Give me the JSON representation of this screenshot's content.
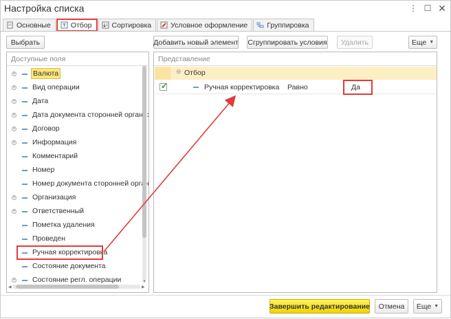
{
  "window": {
    "title": "Настройка списка",
    "more_icon": "more-vertical-icon",
    "maximize_icon": "maximize-icon",
    "close_icon": "close-icon"
  },
  "tabs": [
    {
      "label": "Основные",
      "icon": "document-icon",
      "active": false
    },
    {
      "label": "Отбор",
      "icon": "filter-icon",
      "active": true
    },
    {
      "label": "Сортировка",
      "icon": "sort-icon",
      "active": false
    },
    {
      "label": "Условное оформление",
      "icon": "conditional-format-icon",
      "active": false
    },
    {
      "label": "Группировка",
      "icon": "grouping-icon",
      "active": false
    }
  ],
  "left_panel": {
    "select_button": "Выбрать",
    "header": "Доступные поля",
    "fields": [
      {
        "label": "Валюта",
        "expandable": true,
        "selected": true
      },
      {
        "label": "Вид операции",
        "expandable": true
      },
      {
        "label": "Дата",
        "expandable": true
      },
      {
        "label": "Дата документа сторонней организации",
        "expandable": true
      },
      {
        "label": "Договор",
        "expandable": true
      },
      {
        "label": "Информация",
        "expandable": true
      },
      {
        "label": "Комментарий",
        "expandable": false
      },
      {
        "label": "Номер",
        "expandable": false
      },
      {
        "label": "Номер документа сторонней организации",
        "expandable": false
      },
      {
        "label": "Организация",
        "expandable": true
      },
      {
        "label": "Ответственный",
        "expandable": true
      },
      {
        "label": "Пометка удаления",
        "expandable": false
      },
      {
        "label": "Проведен",
        "expandable": false
      },
      {
        "label": "Ручная корректировка",
        "expandable": false,
        "highlighted": true
      },
      {
        "label": "Состояние документа",
        "expandable": false
      },
      {
        "label": "Состояние регл. операции",
        "expandable": true
      }
    ]
  },
  "right_panel": {
    "add_button": "Добавить новый элемент",
    "group_button": "Сгруппировать условия",
    "delete_button": "Удалить",
    "more_button": "Еще",
    "header": "Представление",
    "group_label": "Отбор",
    "filter": {
      "checked": true,
      "field": "Ручная корректировка",
      "condition": "Равно",
      "value": "Да"
    }
  },
  "footer": {
    "finish_button": "Завершить редактирование",
    "cancel_button": "Отмена",
    "more_button": "Еще"
  },
  "colors": {
    "highlight": "#e23b3b",
    "accent": "#f0d400",
    "group_row": "#fdefc4"
  }
}
